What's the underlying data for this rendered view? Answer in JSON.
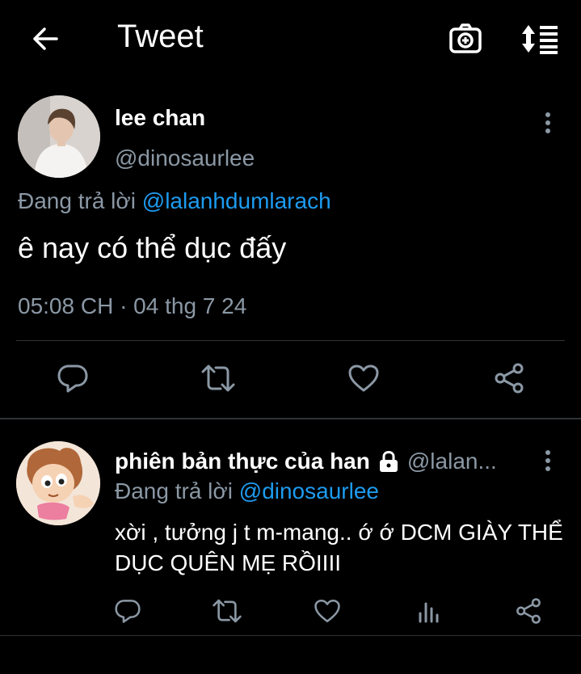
{
  "header": {
    "title": "Tweet",
    "icons": [
      "back-arrow-icon",
      "camera-add-icon",
      "sort-icon"
    ]
  },
  "main_tweet": {
    "display_name": "lee chan",
    "handle": "@dinosaurlee",
    "reply_prefix": "Đang trả lời ",
    "reply_to": "@lalanhdumlarach",
    "text": "ê nay có thể dục đấy",
    "timestamp": "05:08 CH · 04 thg 7 24",
    "actions": [
      "reply-icon",
      "retweet-icon",
      "like-icon",
      "share-icon"
    ]
  },
  "reply_tweet": {
    "display_name": "phiên bản thực của han",
    "handle": "@lalan...",
    "protected": true,
    "reply_prefix": "Đang trả lời ",
    "reply_to": "@dinosaurlee",
    "text": "xời , tưởng j t m-mang.. ớ ớ DCM GIÀY THỂ DỤC QUÊN MẸ RỒIIII",
    "actions": [
      "reply-icon",
      "retweet-icon",
      "like-icon",
      "analytics-icon",
      "share-icon"
    ]
  },
  "colors": {
    "background": "#000000",
    "text": "#ffffff",
    "secondary": "#8b98a5",
    "link": "#1d9bf0",
    "divider": "#2f3336"
  }
}
